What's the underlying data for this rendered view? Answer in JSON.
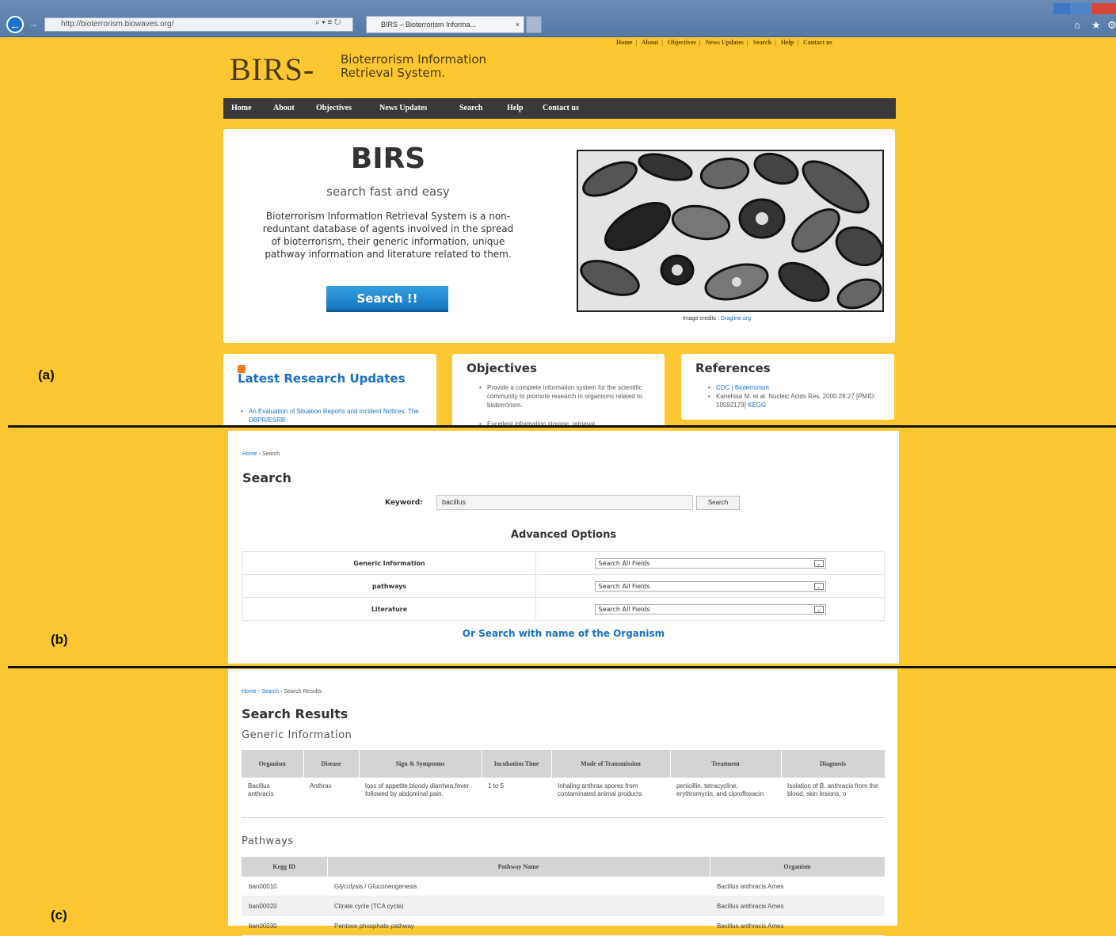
{
  "browser": {
    "url": "http://bioterrorism.biowaves.org/",
    "address_controls": "⌕ ▾ ≡ ↻",
    "tab_title": "BIRS – Bioterrorism Informa...",
    "tab_close": "×"
  },
  "labels": {
    "a": "(a)",
    "b": "(b)",
    "c": "(c)"
  },
  "site": {
    "top_links": [
      "Home",
      "About",
      "Objectives",
      "News Updates",
      "Search",
      "Help",
      "Contact us"
    ],
    "logo": "BIRS-",
    "logo_sub_1": "Bioterrorism Information",
    "logo_sub_2": "Retrieval System.",
    "nav": [
      "Home",
      "About",
      "Objectives",
      "News Updates",
      "Search",
      "Help",
      "Contact us"
    ]
  },
  "hero": {
    "title": "BIRS",
    "tagline": "search fast and easy",
    "description": "Bioterrorism Information Retrieval System is a non-reduntant database of agents involved in the spread of bioterrorism, their generic information, unique pathway information and literature related to them.",
    "button": "Search !!",
    "credit_label": "Image credits :",
    "credit_link": "Dragline.org"
  },
  "cards": {
    "latest": {
      "title": "Latest Research Updates",
      "item": "An Evaluation of Situation Reports and Incident Notices: The DBPR/ESRB"
    },
    "objectives": {
      "title": "Objectives",
      "item1": "Provide a complete information system for the scientific community to promote research in organisms related to bioterrorism.",
      "item2": "Excellent information storage, retrieval"
    },
    "references": {
      "title": "References",
      "item1": "CDC | Bioterrorism",
      "item2": "Kanehisa M. et al. Nucleic Acids Res. 2000 28:27 [PMID: 10592173]",
      "item2_link": "KEGG"
    }
  },
  "search": {
    "breadcrumb_home": "Home",
    "breadcrumb_sep": "›",
    "breadcrumb_current": "Search",
    "heading": "Search",
    "keyword_label": "Keyword:",
    "keyword_value": "bacillus",
    "button": "Search",
    "advanced_heading": "Advanced Options",
    "options": [
      {
        "label": "Generic Information",
        "value": "Search All Fields"
      },
      {
        "label": "pathways",
        "value": "Search All Fields"
      },
      {
        "label": "Literature",
        "value": "Search All Fields"
      }
    ],
    "organism_link": "Or Search with name of the Organism"
  },
  "results": {
    "breadcrumb_home": "Home",
    "breadcrumb_search": "Search",
    "breadcrumb_current": "Search Results",
    "heading": "Search Results",
    "generic_heading": "Generic Information",
    "generic_columns": [
      "Organism",
      "Disease",
      "Sign & Symptoms",
      "Incubation Time",
      "Mode of Transmission",
      "Treatment",
      "Diagnosis"
    ],
    "generic_rows": [
      [
        "Bacillus anthracis",
        "Anthrax",
        "loss of appetite,bloody diarrhea,fever followed by abdominal pain.",
        "1 to 5",
        "Inhaling anthrax spores from contaminated animal products",
        "penicillin, tetracycline, erythromycin, and ciprofloxacin",
        "Isolation of B. anthracis from the blood, skin lesions, o"
      ]
    ],
    "pathways_heading": "Pathways",
    "pathway_columns": [
      "Kegg ID",
      "Pathway Name",
      "Organism"
    ],
    "pathway_rows": [
      [
        "ban00010",
        "Glycolysis / Gluconeogenesis",
        "Bacillus anthracis Ames"
      ],
      [
        "ban00020",
        "Citrate cycle (TCA cycle)",
        "Bacillus anthracis Ames"
      ],
      [
        "ban00030",
        "Pentose phosphate pathway",
        "Bacillus anthracis Ames"
      ]
    ]
  },
  "icons": {
    "back": "back-arrow-icon",
    "forward": "forward-arrow-icon",
    "home": "home-icon",
    "favorites": "star-icon",
    "settings": "gear-icon",
    "rss": "rss-icon",
    "chevron": "chevron-down-icon"
  },
  "colors": {
    "page_bg": "#fcc730",
    "navbar": "#3a3a3a",
    "link": "#1a6fc4",
    "button": "#1e85cf"
  }
}
